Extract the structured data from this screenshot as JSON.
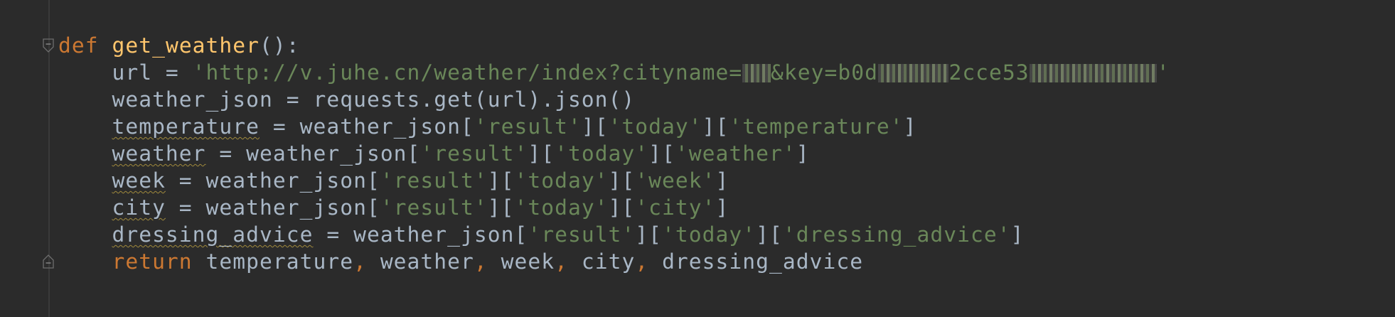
{
  "editor": {
    "lines": [
      {
        "tokens": [
          {
            "t": "def",
            "c": "kw"
          },
          {
            "t": " ",
            "c": "plain"
          },
          {
            "t": "get_weather",
            "c": "fn"
          },
          {
            "t": "():",
            "c": "plain"
          }
        ]
      },
      {
        "tokens": [
          {
            "t": "    url = ",
            "c": "plain"
          },
          {
            "t": "'http://v.juhe.cn/weather/index?cityname=",
            "c": "str"
          },
          {
            "redact": 2
          },
          {
            "t": "&key=b0d",
            "c": "str"
          },
          {
            "redact": 5
          },
          {
            "t": "2cce53",
            "c": "str"
          },
          {
            "redact": 9
          },
          {
            "t": "'",
            "c": "str"
          }
        ]
      },
      {
        "tokens": [
          {
            "t": "    weather_json = requests.get(url).json()",
            "c": "plain"
          }
        ]
      },
      {
        "tokens": [
          {
            "t": "    ",
            "c": "plain"
          },
          {
            "t": "temperature",
            "c": "plain",
            "warn": true
          },
          {
            "t": " = weather_json[",
            "c": "plain"
          },
          {
            "t": "'result'",
            "c": "str"
          },
          {
            "t": "][",
            "c": "plain"
          },
          {
            "t": "'today'",
            "c": "str"
          },
          {
            "t": "][",
            "c": "plain"
          },
          {
            "t": "'temperature'",
            "c": "str"
          },
          {
            "t": "]",
            "c": "plain"
          }
        ]
      },
      {
        "tokens": [
          {
            "t": "    ",
            "c": "plain"
          },
          {
            "t": "weather",
            "c": "plain",
            "warn": true
          },
          {
            "t": " = weather_json[",
            "c": "plain"
          },
          {
            "t": "'result'",
            "c": "str"
          },
          {
            "t": "][",
            "c": "plain"
          },
          {
            "t": "'today'",
            "c": "str"
          },
          {
            "t": "][",
            "c": "plain"
          },
          {
            "t": "'weather'",
            "c": "str"
          },
          {
            "t": "]",
            "c": "plain"
          }
        ]
      },
      {
        "tokens": [
          {
            "t": "    ",
            "c": "plain"
          },
          {
            "t": "week",
            "c": "plain",
            "warn": true
          },
          {
            "t": " = weather_json[",
            "c": "plain"
          },
          {
            "t": "'result'",
            "c": "str"
          },
          {
            "t": "][",
            "c": "plain"
          },
          {
            "t": "'today'",
            "c": "str"
          },
          {
            "t": "][",
            "c": "plain"
          },
          {
            "t": "'week'",
            "c": "str"
          },
          {
            "t": "]",
            "c": "plain"
          }
        ]
      },
      {
        "tokens": [
          {
            "t": "    ",
            "c": "plain"
          },
          {
            "t": "city",
            "c": "plain",
            "warn": true
          },
          {
            "t": " = weather_json[",
            "c": "plain"
          },
          {
            "t": "'result'",
            "c": "str"
          },
          {
            "t": "][",
            "c": "plain"
          },
          {
            "t": "'today'",
            "c": "str"
          },
          {
            "t": "][",
            "c": "plain"
          },
          {
            "t": "'city'",
            "c": "str"
          },
          {
            "t": "]",
            "c": "plain"
          }
        ]
      },
      {
        "tokens": [
          {
            "t": "    ",
            "c": "plain"
          },
          {
            "t": "dressing_advice",
            "c": "plain",
            "warn": true
          },
          {
            "t": " = weather_json[",
            "c": "plain"
          },
          {
            "t": "'result'",
            "c": "str"
          },
          {
            "t": "][",
            "c": "plain"
          },
          {
            "t": "'today'",
            "c": "str"
          },
          {
            "t": "][",
            "c": "plain"
          },
          {
            "t": "'dressing_advice'",
            "c": "str"
          },
          {
            "t": "]",
            "c": "plain"
          }
        ]
      },
      {
        "tokens": [
          {
            "t": "    ",
            "c": "plain"
          },
          {
            "t": "return",
            "c": "kw"
          },
          {
            "t": " temperature",
            "c": "plain"
          },
          {
            "t": ",",
            "c": "punc"
          },
          {
            "t": " weather",
            "c": "plain"
          },
          {
            "t": ",",
            "c": "punc"
          },
          {
            "t": " week",
            "c": "plain"
          },
          {
            "t": ",",
            "c": "punc"
          },
          {
            "t": " city",
            "c": "plain"
          },
          {
            "t": ",",
            "c": "punc"
          },
          {
            "t": " dressing_advice",
            "c": "plain"
          }
        ]
      }
    ],
    "fold_markers": [
      {
        "line": 0,
        "icon": "fold-open-icon"
      },
      {
        "line": 8,
        "icon": "fold-close-icon"
      }
    ],
    "colors": {
      "background": "#2b2b2b",
      "keyword": "#cc7832",
      "function": "#ffc66d",
      "string": "#6a8759",
      "plain": "#a9b7c6",
      "warning_underline": "#a08a3c"
    }
  }
}
